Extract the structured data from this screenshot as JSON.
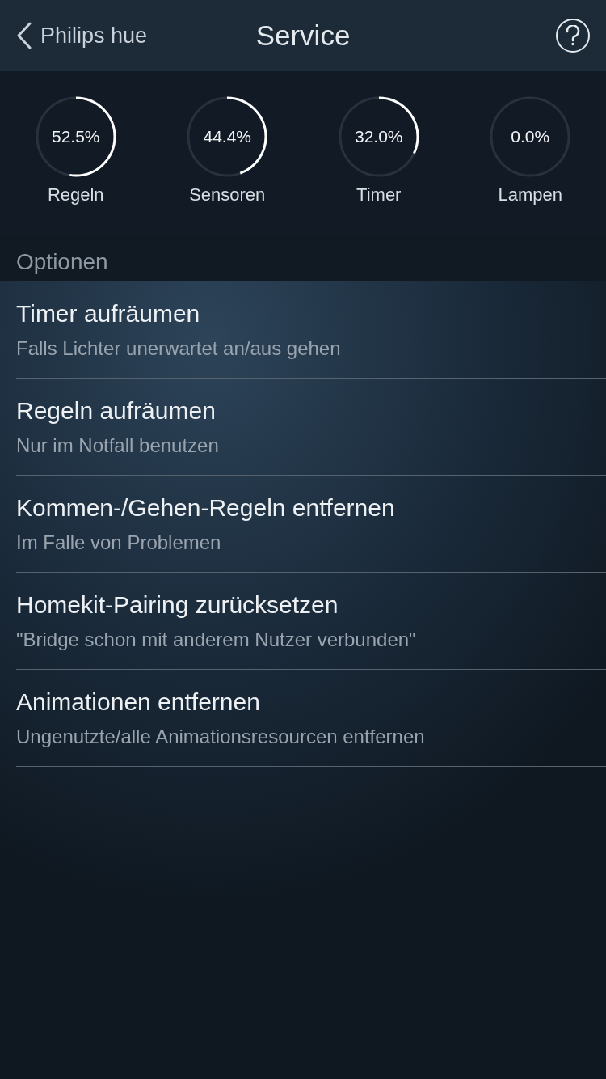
{
  "nav": {
    "back_label": "Philips hue",
    "title": "Service"
  },
  "gauges": [
    {
      "value": "52.5%",
      "label": "Regeln",
      "level": 0.525
    },
    {
      "value": "44.4%",
      "label": "Sensoren",
      "level": 0.444
    },
    {
      "value": "32.0%",
      "label": "Timer",
      "level": 0.32
    },
    {
      "value": "0.0%",
      "label": "Lampen",
      "level": 0.0
    }
  ],
  "section_title": "Optionen",
  "options": [
    {
      "title": "Timer aufräumen",
      "subtitle": "Falls Lichter unerwartet an/aus gehen"
    },
    {
      "title": "Regeln aufräumen",
      "subtitle": "Nur im Notfall benutzen"
    },
    {
      "title": "Kommen-/Gehen-Regeln entfernen",
      "subtitle": "Im Falle von Problemen"
    },
    {
      "title": "Homekit-Pairing zurücksetzen",
      "subtitle": "\"Bridge schon mit anderem Nutzer verbunden\""
    },
    {
      "title": "Animationen entfernen",
      "subtitle": "Ungenutzte/alle Animationsresourcen entfernen"
    }
  ]
}
